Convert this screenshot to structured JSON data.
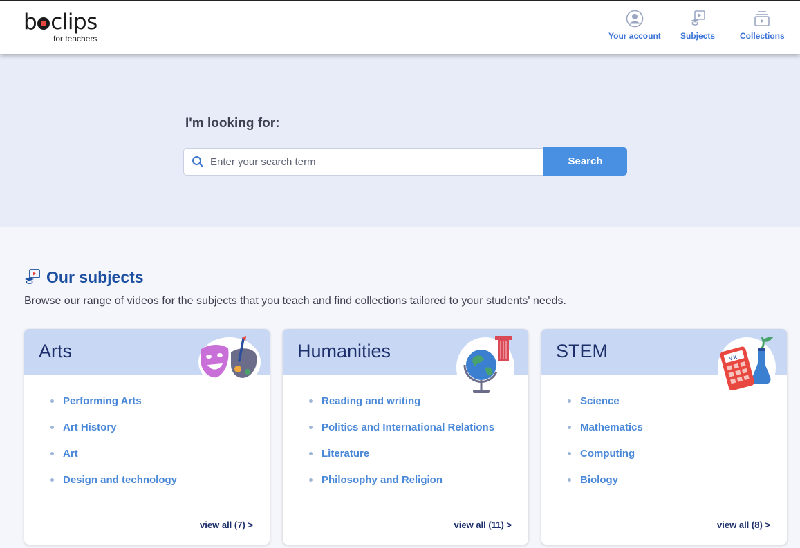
{
  "header": {
    "logo_main_pre": "b",
    "logo_main_post": "clips",
    "logo_sub": "for teachers",
    "nav": [
      {
        "label": "Your account",
        "icon": "account-icon"
      },
      {
        "label": "Subjects",
        "icon": "subjects-icon"
      },
      {
        "label": "Collections",
        "icon": "collections-icon"
      }
    ]
  },
  "hero": {
    "title": "I'm looking for:",
    "search_placeholder": "Enter your search term",
    "search_button": "Search"
  },
  "subjects": {
    "title": "Our subjects",
    "description": "Browse our range of videos for the subjects that you teach and find collections tailored to your students' needs.",
    "cards": [
      {
        "title": "Arts",
        "items": [
          "Performing Arts",
          "Art History",
          "Art",
          "Design and technology"
        ],
        "view_all": "view all (7) >"
      },
      {
        "title": "Humanities",
        "items": [
          "Reading and writing",
          "Politics and International Relations",
          "Literature",
          "Philosophy and Religion"
        ],
        "view_all": "view all (11) >"
      },
      {
        "title": "STEM",
        "items": [
          "Science",
          "Mathematics",
          "Computing",
          "Biology"
        ],
        "view_all": "view all (8) >"
      }
    ]
  },
  "colors": {
    "accent": "#4a90e2",
    "link": "#4a88d8",
    "heading": "#1c4fa0",
    "hero_bg": "#e8ecf8",
    "card_head": "#c8d7f3"
  }
}
